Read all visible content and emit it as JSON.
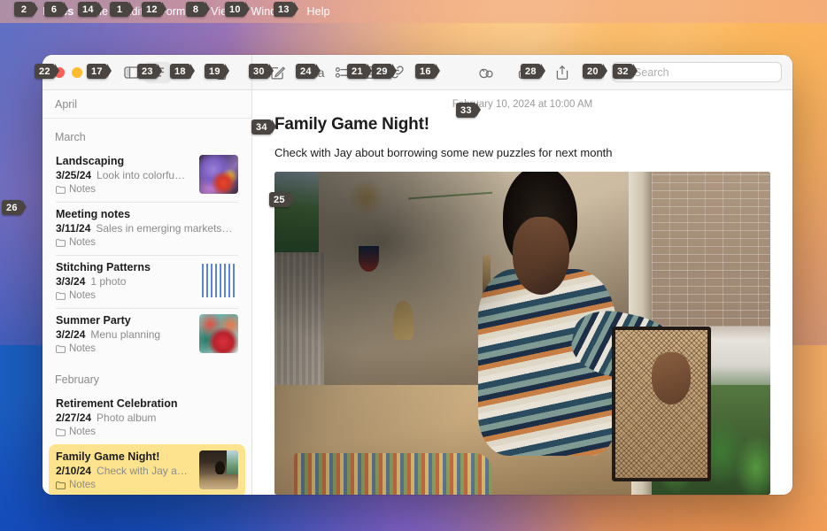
{
  "menubar": {
    "apple_icon": "apple-logo",
    "items": [
      {
        "label": "Notes",
        "badge": "6",
        "app": true
      },
      {
        "label": "File",
        "badge": "14"
      },
      {
        "label": "Edit",
        "badge": "1"
      },
      {
        "label": "Format",
        "badge": "12"
      },
      {
        "label": "View",
        "badge": "8"
      },
      {
        "label": "Window",
        "badge": "10"
      },
      {
        "label": "Help",
        "badge": "13"
      }
    ],
    "apple_badge": "2"
  },
  "window": {
    "traffic_lights": {
      "close_badge": "22",
      "close": "close-button",
      "minimize": "minimize-button",
      "zoom_badge": "17",
      "zoom": "zoom-button"
    },
    "toolbar": {
      "sidebar_toggle": {
        "name": "sidebar-toggle-icon",
        "badge": ""
      },
      "list_view": {
        "name": "list-view-icon",
        "badge": "23"
      },
      "gallery_view": {
        "name": "gallery-view-icon",
        "badge": "18"
      },
      "delete": {
        "name": "trash-icon",
        "badge": "19"
      },
      "compose": {
        "name": "compose-note-icon",
        "badge": "30"
      },
      "format": {
        "name": "format-aa-icon",
        "label": "Aa",
        "badge": "24"
      },
      "checklist": {
        "name": "checklist-icon",
        "badge": "21"
      },
      "table": {
        "name": "table-icon",
        "badge": "29"
      },
      "link": {
        "name": "link-icon",
        "badge": "16"
      },
      "media": {
        "name": "media-icon",
        "badge": ""
      },
      "collaborate": {
        "name": "collaborate-icon",
        "badge": "28"
      },
      "lock": {
        "name": "lock-icon",
        "badge": ""
      },
      "share": {
        "name": "share-icon",
        "badge": "20"
      }
    },
    "search": {
      "placeholder": "Search",
      "value": "",
      "badge": "32",
      "icon": "search-icon"
    }
  },
  "notelist": {
    "pinned_month": "April",
    "sections": [
      {
        "month": "March",
        "notes": [
          {
            "title": "Landscaping",
            "date": "3/25/24",
            "snippet": "Look into colorfu…",
            "folder": "Notes",
            "thumb": "th-iris",
            "selected": false
          },
          {
            "title": "Meeting notes",
            "date": "3/11/24",
            "snippet": "Sales in emerging markets…",
            "folder": "Notes",
            "thumb": "",
            "selected": false
          },
          {
            "title": "Stitching Patterns",
            "date": "3/3/24",
            "snippet": "1 photo",
            "folder": "Notes",
            "thumb": "th-stitch",
            "selected": false
          },
          {
            "title": "Summer Party",
            "date": "3/2/24",
            "snippet": "Menu planning",
            "folder": "Notes",
            "thumb": "th-food",
            "selected": false
          }
        ]
      },
      {
        "month": "February",
        "notes": [
          {
            "title": "Retirement Celebration",
            "date": "2/27/24",
            "snippet": "Photo album",
            "folder": "Notes",
            "thumb": "",
            "selected": false
          },
          {
            "title": "Family Game Night!",
            "date": "2/10/24",
            "snippet": "Check with Jay a…",
            "folder": "Notes",
            "thumb": "th-boy",
            "selected": true
          }
        ]
      }
    ]
  },
  "detail": {
    "date": "February 10, 2024 at 10:00 AM",
    "date_badge": "33",
    "title": "Family Game Night!",
    "title_badge": "34",
    "body": "Check with Jay about borrowing some new puzzles for next month",
    "photo": {
      "name": "note-photo",
      "badge": "25",
      "alt": "Boy at a dining table with a jigsaw puzzle"
    }
  },
  "desktop": {
    "badge": "26"
  },
  "colors": {
    "selection_yellow": "#fde38d",
    "traffic_red": "#ff5f57",
    "traffic_yellow": "#febc2e",
    "traffic_green": "#28c840",
    "badge_bg": "#4a4540"
  }
}
